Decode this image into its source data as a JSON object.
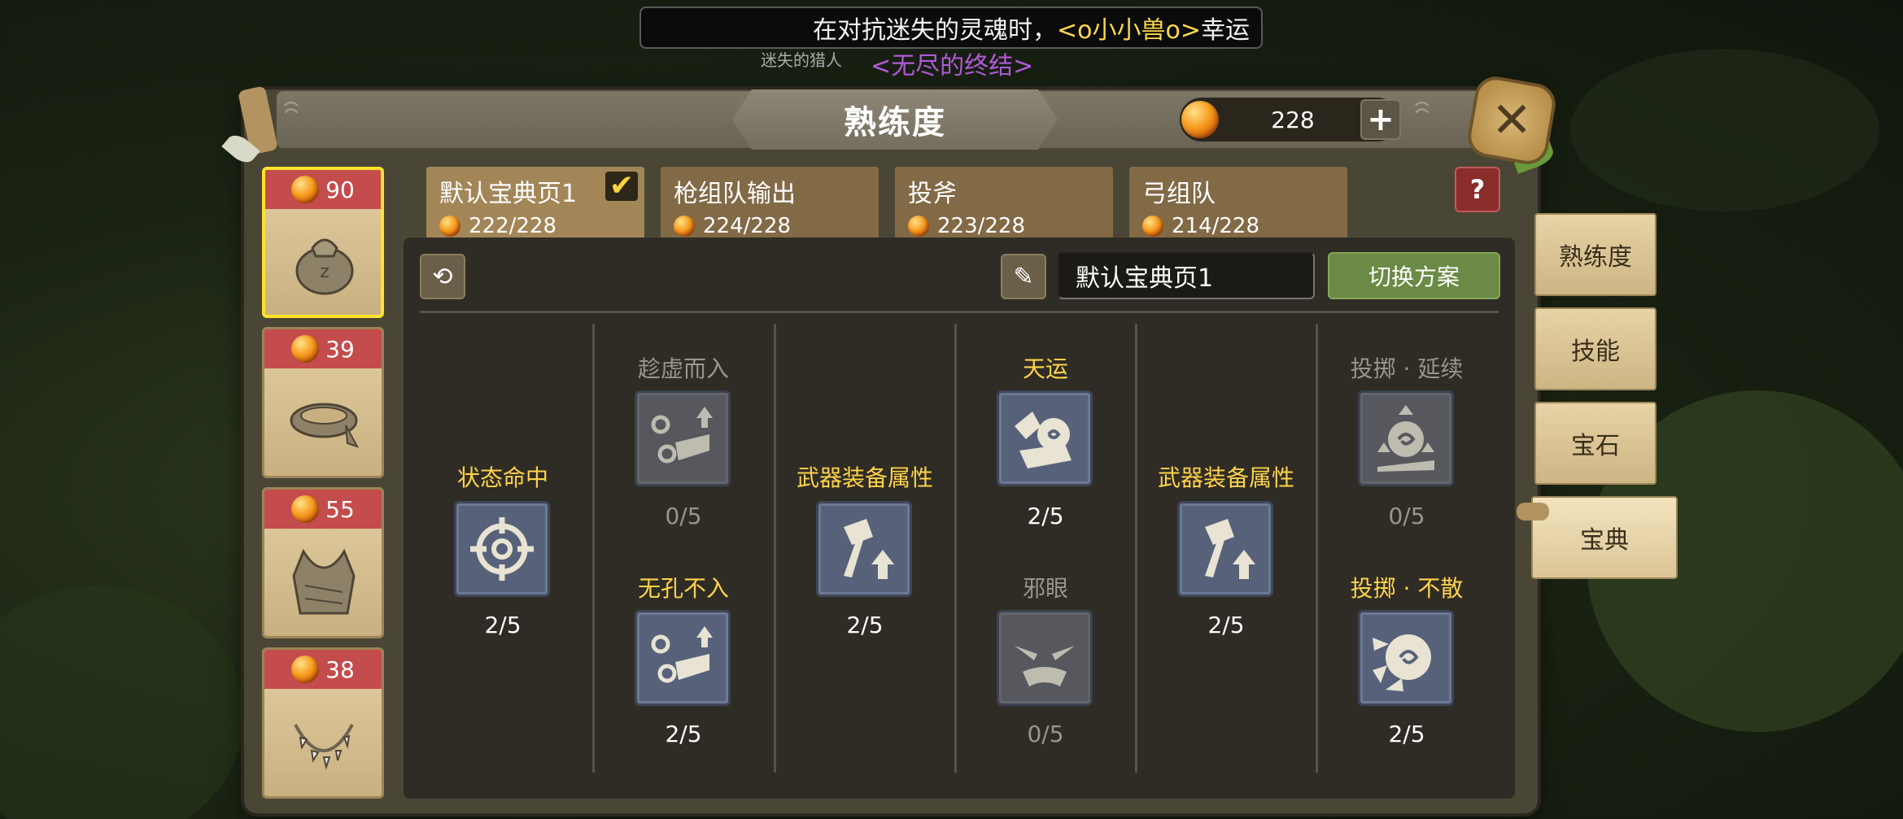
{
  "notification": {
    "text_before": "在对抗迷失的灵魂时，",
    "player": "<o小小兽o>",
    "text_after": "幸运"
  },
  "background_texts": {
    "npc_label": "迷失的猎人",
    "guild_tag": "<无尽的终结>"
  },
  "header": {
    "title": "熟练度",
    "currency_value": "228",
    "plus_label": "+",
    "close_label": "✕"
  },
  "help_label": "?",
  "item_cards": [
    {
      "cost": "90",
      "item": "pouch",
      "selected": true
    },
    {
      "cost": "39",
      "item": "belt"
    },
    {
      "cost": "55",
      "item": "vest"
    },
    {
      "cost": "38",
      "item": "necklace"
    }
  ],
  "pages": [
    {
      "name": "默认宝典页1",
      "cost": "222/228",
      "active": true
    },
    {
      "name": "枪组队输出",
      "cost": "224/228"
    },
    {
      "name": "投斧",
      "cost": "223/228"
    },
    {
      "name": "弓组队",
      "cost": "214/228"
    }
  ],
  "toolbar": {
    "page_name_value": "默认宝典页1",
    "switch_label": "切换方案",
    "refresh_icon": "refresh-icon",
    "edit_icon": "pencil-icon"
  },
  "skills": [
    {
      "name": "状态命中",
      "level": "2/5",
      "state": "active",
      "icon": "crosshair"
    },
    {
      "name": "趁虚而入",
      "level": "0/5",
      "state": "inactive",
      "icon": "throw-stones"
    },
    {
      "name": "无孔不入",
      "level": "2/5",
      "state": "active",
      "icon": "throw-stones"
    },
    {
      "name": "武器装备属性",
      "level": "2/5",
      "state": "active",
      "icon": "hammer-up"
    },
    {
      "name": "天运",
      "level": "2/5",
      "state": "active",
      "icon": "fist-swirl"
    },
    {
      "name": "邪眼",
      "level": "0/5",
      "state": "inactive",
      "icon": "evil-eye"
    },
    {
      "name": "武器装备属性",
      "level": "2/5",
      "state": "active",
      "icon": "hammer-up"
    },
    {
      "name": "投掷 · 延续",
      "level": "0/5",
      "state": "inactive",
      "icon": "swirl-arrows"
    },
    {
      "name": "投掷 · 不散",
      "level": "2/5",
      "state": "active",
      "icon": "swirl-burst"
    }
  ],
  "side_tabs": [
    {
      "label": "熟练度"
    },
    {
      "label": "技能"
    },
    {
      "label": "宝石"
    },
    {
      "label": "宝典",
      "active": true
    }
  ],
  "colors": {
    "panel": "#4a4636",
    "gold_text": "#ffd34a",
    "card_head": "#c44c4c",
    "switch_button": "#6b8a45"
  }
}
